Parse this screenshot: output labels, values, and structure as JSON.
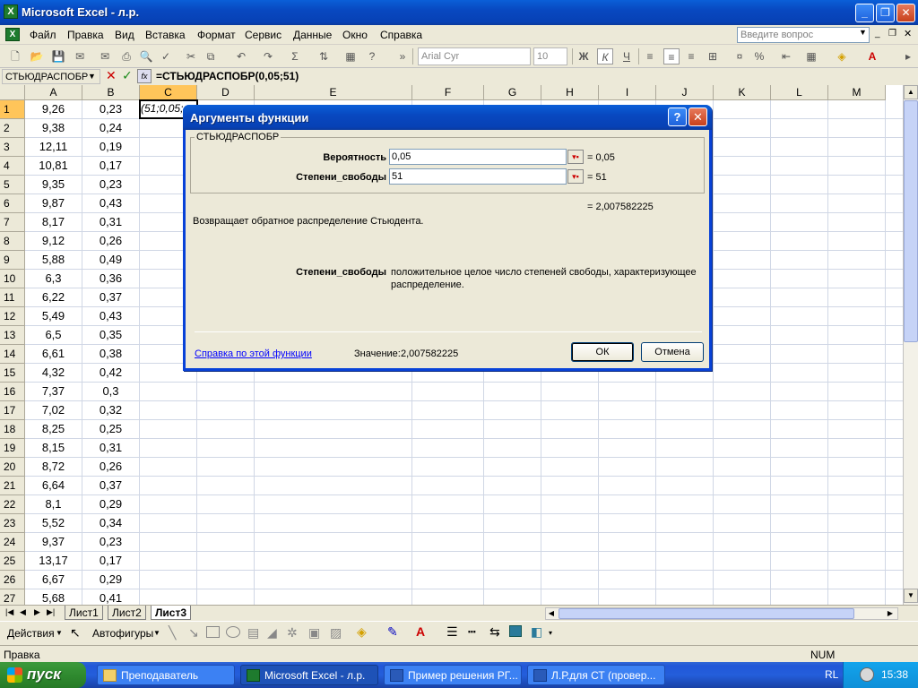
{
  "window": {
    "title": "Microsoft Excel - л.р."
  },
  "menu": [
    "Файл",
    "Правка",
    "Вид",
    "Вставка",
    "Формат",
    "Сервис",
    "Данные",
    "Окно",
    "Справка"
  ],
  "ask_placeholder": "Введите вопрос",
  "toolbar": {
    "font_name": "Arial Cyr",
    "font_size": "10",
    "bold": "Ж",
    "italic": "К",
    "underline": "Ч",
    "percent": "%"
  },
  "formula_bar": {
    "name_box": "СТЬЮДРАСПОБР",
    "fx": "fx",
    "formula": "=СТЬЮДРАСПОБР(0,05;51)"
  },
  "columns": [
    "A",
    "B",
    "C",
    "D",
    "E",
    "F",
    "G",
    "H",
    "I",
    "J",
    "K",
    "L",
    "M"
  ],
  "rows": [
    {
      "n": "1",
      "a": "9,26",
      "b": "0,23"
    },
    {
      "n": "2",
      "a": "9,38",
      "b": "0,24"
    },
    {
      "n": "3",
      "a": "12,11",
      "b": "0,19"
    },
    {
      "n": "4",
      "a": "10,81",
      "b": "0,17"
    },
    {
      "n": "5",
      "a": "9,35",
      "b": "0,23"
    },
    {
      "n": "6",
      "a": "9,87",
      "b": "0,43"
    },
    {
      "n": "7",
      "a": "8,17",
      "b": "0,31"
    },
    {
      "n": "8",
      "a": "9,12",
      "b": "0,26"
    },
    {
      "n": "9",
      "a": "5,88",
      "b": "0,49"
    },
    {
      "n": "10",
      "a": "6,3",
      "b": "0,36"
    },
    {
      "n": "11",
      "a": "6,22",
      "b": "0,37"
    },
    {
      "n": "12",
      "a": "5,49",
      "b": "0,43"
    },
    {
      "n": "13",
      "a": "6,5",
      "b": "0,35"
    },
    {
      "n": "14",
      "a": "6,61",
      "b": "0,38"
    },
    {
      "n": "15",
      "a": "4,32",
      "b": "0,42"
    },
    {
      "n": "16",
      "a": "7,37",
      "b": "0,3"
    },
    {
      "n": "17",
      "a": "7,02",
      "b": "0,32"
    },
    {
      "n": "18",
      "a": "8,25",
      "b": "0,25"
    },
    {
      "n": "19",
      "a": "8,15",
      "b": "0,31"
    },
    {
      "n": "20",
      "a": "8,72",
      "b": "0,26"
    },
    {
      "n": "21",
      "a": "6,64",
      "b": "0,37"
    },
    {
      "n": "22",
      "a": "8,1",
      "b": "0,29"
    },
    {
      "n": "23",
      "a": "5,52",
      "b": "0,34"
    },
    {
      "n": "24",
      "a": "9,37",
      "b": "0,23"
    },
    {
      "n": "25",
      "a": "13,17",
      "b": "0,17"
    },
    {
      "n": "26",
      "a": "6,67",
      "b": "0,29"
    },
    {
      "n": "27",
      "a": "5,68",
      "b": "0,41"
    }
  ],
  "active_cell_text": ";0,05;51)",
  "dialog": {
    "title": "Аргументы функции",
    "help_btn": "?",
    "close_btn": "✕",
    "function_name": "СТЬЮДРАСПОБР",
    "args": [
      {
        "label": "Вероятность",
        "value": "0,05",
        "result": "= 0,05"
      },
      {
        "label": "Степени_свободы",
        "value": "51",
        "result": "= 51"
      }
    ],
    "total_result": "= 2,007582225",
    "description": "Возвращает обратное распределение Стьюдента.",
    "arg_help_label": "Степени_свободы",
    "arg_help_text_1": "положительное целое число степеней свободы, характеризующее",
    "arg_help_text_2": "распределение.",
    "help_link": "Справка по этой функции",
    "value_label": "Значение:",
    "value": "2,007582225",
    "ok": "ОК",
    "cancel": "Отмена"
  },
  "sheet_tabs": [
    "Лист1",
    "Лист2",
    "Лист3"
  ],
  "active_sheet": "Лист3",
  "drawing": {
    "actions": "Действия",
    "autoshapes": "Автофигуры"
  },
  "status": {
    "left": "Правка",
    "num": "NUM"
  },
  "taskbar": {
    "start": "пуск",
    "tasks": [
      "Преподаватель",
      "Microsoft Excel - л.р.",
      "Пример решения РГ...",
      "Л.Р.для СТ (провер..."
    ],
    "lang": "RL",
    "time": "15:38"
  }
}
